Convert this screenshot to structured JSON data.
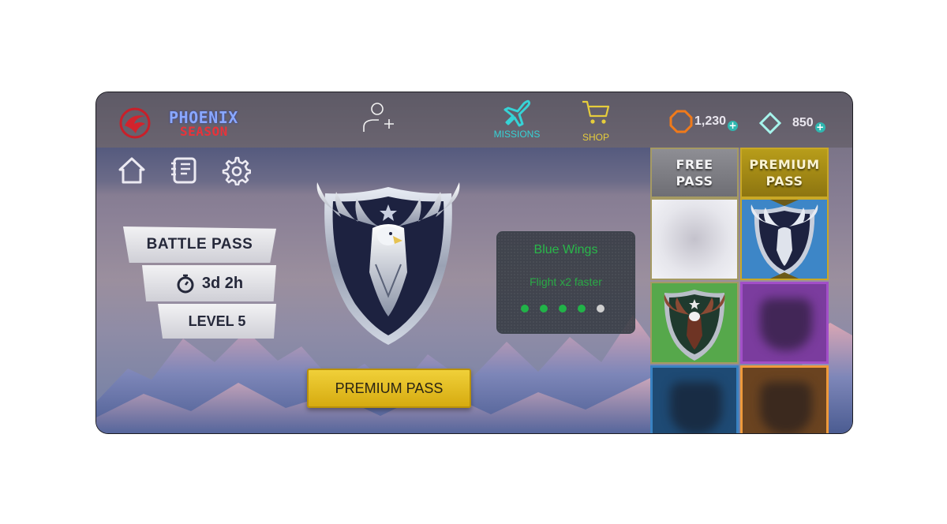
{
  "header": {
    "title_line1": "PHOENIX",
    "title_line2": "SEASON",
    "missions_label": "MISSIONS",
    "shop_label": "SHOP",
    "coins": "1,230",
    "gems": "850",
    "plus": "+"
  },
  "nav": {
    "icons": [
      "home-icon",
      "journal-icon",
      "gear-icon"
    ]
  },
  "battle_pass": {
    "title": "BATTLE PASS",
    "timer": "3d 2h",
    "level": "LEVEL 5"
  },
  "premium_button": "PREMIUM PASS",
  "reward_info": {
    "name": "Blue Wings",
    "description": "Flight x2 faster",
    "progress_filled": 4,
    "progress_total": 5
  },
  "reward_columns": {
    "free_line1": "FREE",
    "free_line2": "PASS",
    "premium_line1": "PREMIUM",
    "premium_line2": "PASS"
  },
  "colors": {
    "accent_teal": "#36d3d6",
    "shop_yellow": "#e6cd3c",
    "premium_gold": "#d6ab10",
    "info_green": "#29b84a",
    "title_blue": "#8aa8ff",
    "title_red": "#e8333a"
  }
}
